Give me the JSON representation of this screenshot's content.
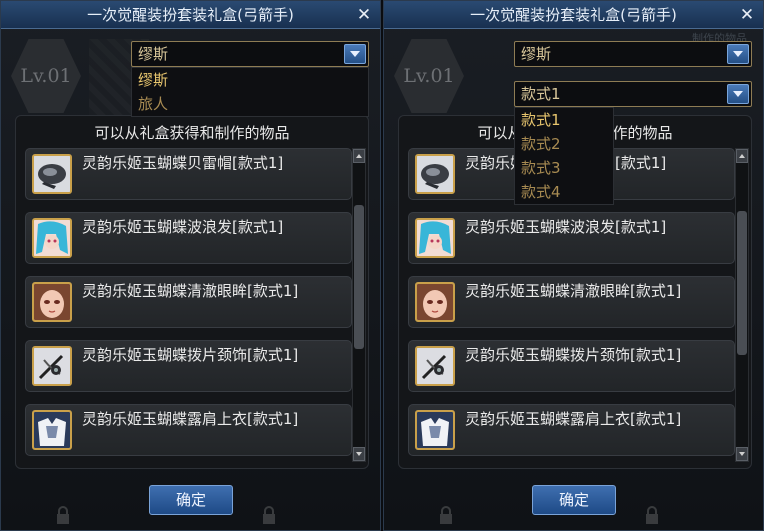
{
  "dialog_title": "一次觉醒装扮套装礼盒(弓箭手)",
  "close_symbol": "✕",
  "background": {
    "level": "Lv.01",
    "faded_text": "制作的物品"
  },
  "panels": [
    {
      "select1": {
        "value": "缪斯",
        "expanded": true
      },
      "select1_options": [
        "缪斯",
        "旅人"
      ],
      "content_title": "可以从礼盒获得和制作的物品",
      "items": [
        {
          "icon": "hat-icon",
          "label": "灵韵乐姬玉蝴蝶贝雷帽[款式1]"
        },
        {
          "icon": "hair-icon",
          "label": "灵韵乐姬玉蝴蝶波浪发[款式1]"
        },
        {
          "icon": "face-icon",
          "label": "灵韵乐姬玉蝴蝶清澈眼眸[款式1]"
        },
        {
          "icon": "neck-icon",
          "label": "灵韵乐姬玉蝴蝶拨片颈饰[款式1]"
        },
        {
          "icon": "top-icon",
          "label": "灵韵乐姬玉蝴蝶露肩上衣[款式1]"
        }
      ],
      "confirm_label": "确定"
    },
    {
      "select1": {
        "value": "缪斯",
        "expanded": false
      },
      "select2": {
        "value": "款式1",
        "expanded": true
      },
      "select2_options": [
        "款式1",
        "款式2",
        "款式3",
        "款式4"
      ],
      "content_title": "可以从礼盒获得和制作的物品",
      "items": [
        {
          "icon": "hat-icon",
          "label": "灵韵乐姬玉蝴蝶贝雷帽[款式1]"
        },
        {
          "icon": "hair-icon",
          "label": "灵韵乐姬玉蝴蝶波浪发[款式1]"
        },
        {
          "icon": "face-icon",
          "label": "灵韵乐姬玉蝴蝶清澈眼眸[款式1]"
        },
        {
          "icon": "neck-icon",
          "label": "灵韵乐姬玉蝴蝶拨片颈饰[款式1]"
        },
        {
          "icon": "top-icon",
          "label": "灵韵乐姬玉蝴蝶露肩上衣[款式1]"
        }
      ],
      "confirm_label": "确定"
    }
  ],
  "colors": {
    "title_bar": "#1f3d63",
    "accent_gold": "#e8c66e",
    "button_blue": "#2f5e9e"
  }
}
